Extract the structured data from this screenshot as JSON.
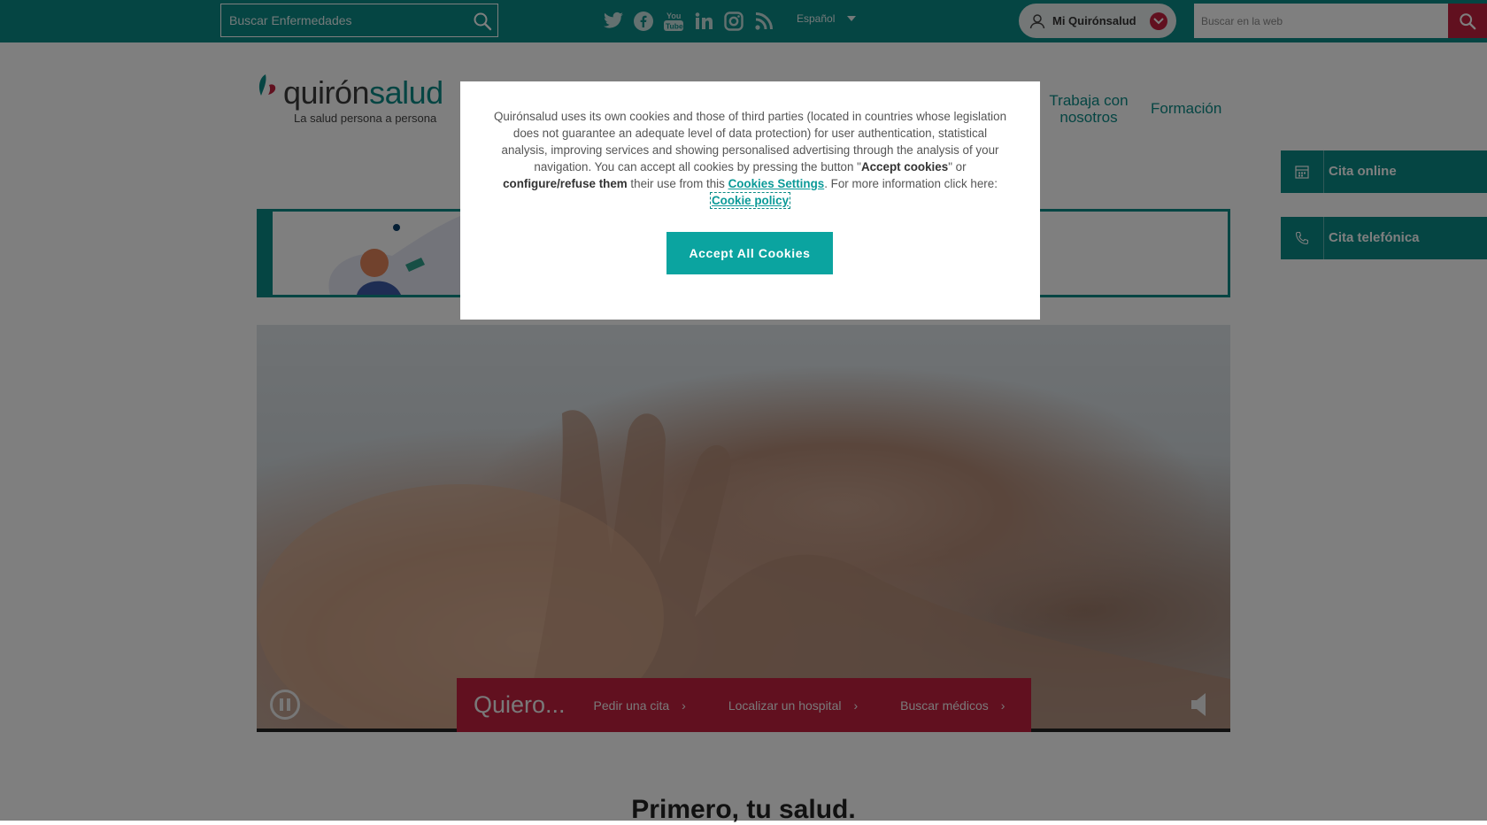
{
  "topbar": {
    "disease_search_placeholder": "Buscar Enfermedades",
    "social_icons": [
      "twitter-icon",
      "facebook-icon",
      "youtube-icon",
      "linkedin-icon",
      "instagram-icon",
      "rss-icon"
    ],
    "language": "Español",
    "mi_label": "Mi Quirónsalud",
    "web_search_placeholder": "Buscar en la web"
  },
  "header": {
    "brand_part1": "quirón",
    "brand_part2": "salud",
    "tagline": "La salud persona a persona",
    "nav": {
      "trabaja": "Trabaja con nosotros",
      "formacion": "Formación"
    }
  },
  "side_tabs": {
    "cita_online": "Cita online",
    "cita_telefonica": "Cita telefónica"
  },
  "hero": {
    "quiero": "Quiero...",
    "links": [
      "Pedir una cita",
      "Localizar un hospital",
      "Buscar médicos"
    ]
  },
  "headline": "Primero, tu salud.",
  "cookie_modal": {
    "text_1": "Quirónsalud uses its own cookies and those of third parties (located in countries whose legislation does not guarantee an adequate level of data protection) for user authentication, statistical analysis, improving services and showing personalised advertising through the analysis of your navigation. You can accept all cookies by pressing the button \"",
    "accept_bold": "Accept cookies",
    "text_2": "\" or ",
    "configure_bold": "configure/refuse them",
    "text_3": " their use from this ",
    "settings_link": "Cookies Settings",
    "text_4": ". For more information click here: ",
    "policy_link": "Cookie policy",
    "accept_button": "Accept All Cookies"
  },
  "colors": {
    "teal": "#0b8a86",
    "crimson": "#c2203f",
    "accept_button": "#0ba4a0"
  }
}
